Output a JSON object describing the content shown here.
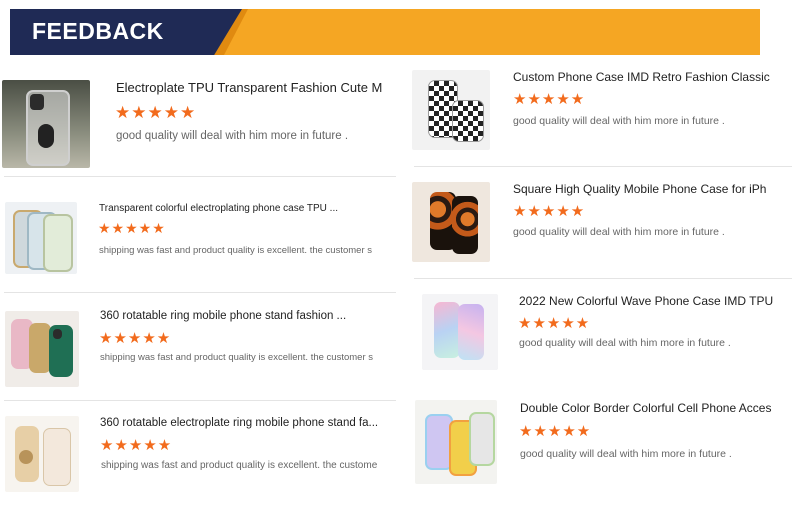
{
  "header": {
    "title": "FEEDBACK"
  },
  "rating_icon": "star-icon",
  "star_color": "#f26b1d",
  "colors": {
    "banner_navy": "#1f2a55",
    "banner_orange": "#f5a623"
  },
  "left_reviews": [
    {
      "product": "Electroplate TPU Transparent Fashion Cute M",
      "stars": "★★★★★",
      "rating": 5,
      "review": "good quality will deal with him more in future ."
    },
    {
      "product": "Transparent colorful electroplating phone case TPU ...",
      "stars": "★★★★★",
      "rating": 5,
      "review": "shipping was fast and product quality is excellent. the customer s"
    },
    {
      "product": "360 rotatable ring mobile phone stand fashion ...",
      "stars": "★★★★★",
      "rating": 5,
      "review": "shipping was fast and product quality is excellent. the customer s"
    },
    {
      "product": "360 rotatable electroplate ring mobile phone stand fa...",
      "stars": "★★★★★",
      "rating": 5,
      "review": "shipping was fast and product quality is excellent. the custome"
    }
  ],
  "right_reviews": [
    {
      "product": "Custom Phone Case IMD Retro Fashion Classic",
      "stars": "★★★★★",
      "rating": 5,
      "review": "good quality will deal with him more in future ."
    },
    {
      "product": "Square High Quality Mobile Phone Case for iPh",
      "stars": "★★★★★",
      "rating": 5,
      "review": "good quality will deal with him more in future ."
    },
    {
      "product": "2022 New Colorful Wave Phone Case IMD TPU",
      "stars": "★★★★★",
      "rating": 5,
      "review": "good quality will deal with him more in future ."
    },
    {
      "product": "Double Color Border Colorful Cell Phone Acces",
      "stars": "★★★★★",
      "rating": 5,
      "review": "good quality will deal with him more in future ."
    }
  ]
}
